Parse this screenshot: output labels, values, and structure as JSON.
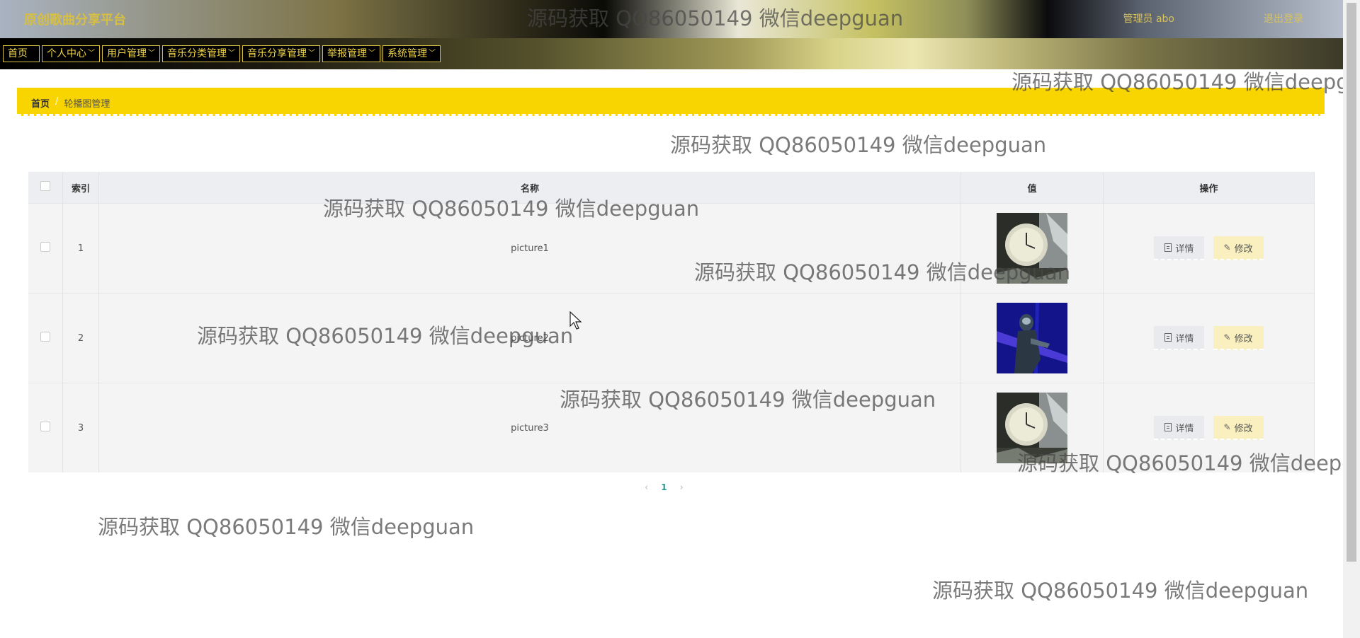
{
  "header": {
    "brand": "原创歌曲分享平台",
    "user_info": "管理员 abo",
    "logout": "退出登录"
  },
  "nav": {
    "items": [
      {
        "label": "首页",
        "dropdown": false
      },
      {
        "label": "个人中心",
        "dropdown": true
      },
      {
        "label": "用户管理",
        "dropdown": true
      },
      {
        "label": "音乐分类管理",
        "dropdown": true
      },
      {
        "label": "音乐分享管理",
        "dropdown": true
      },
      {
        "label": "举报管理",
        "dropdown": true
      },
      {
        "label": "系统管理",
        "dropdown": true
      }
    ]
  },
  "breadcrumb": {
    "home": "首页",
    "separator": "/",
    "current": "轮播图管理"
  },
  "table": {
    "columns": {
      "index": "索引",
      "name": "名称",
      "value": "值",
      "actions": "操作"
    },
    "rows": [
      {
        "index": "1",
        "name": "picture1",
        "image": "clock"
      },
      {
        "index": "2",
        "name": "picture2",
        "image": "blue-figure"
      },
      {
        "index": "3",
        "name": "picture3",
        "image": "clock"
      }
    ],
    "detail_label": "详情",
    "edit_label": "修改"
  },
  "pagination": {
    "prev": "‹",
    "current": "1",
    "next": "›"
  },
  "watermark": "源码获取 QQ86050149 微信deepguan"
}
